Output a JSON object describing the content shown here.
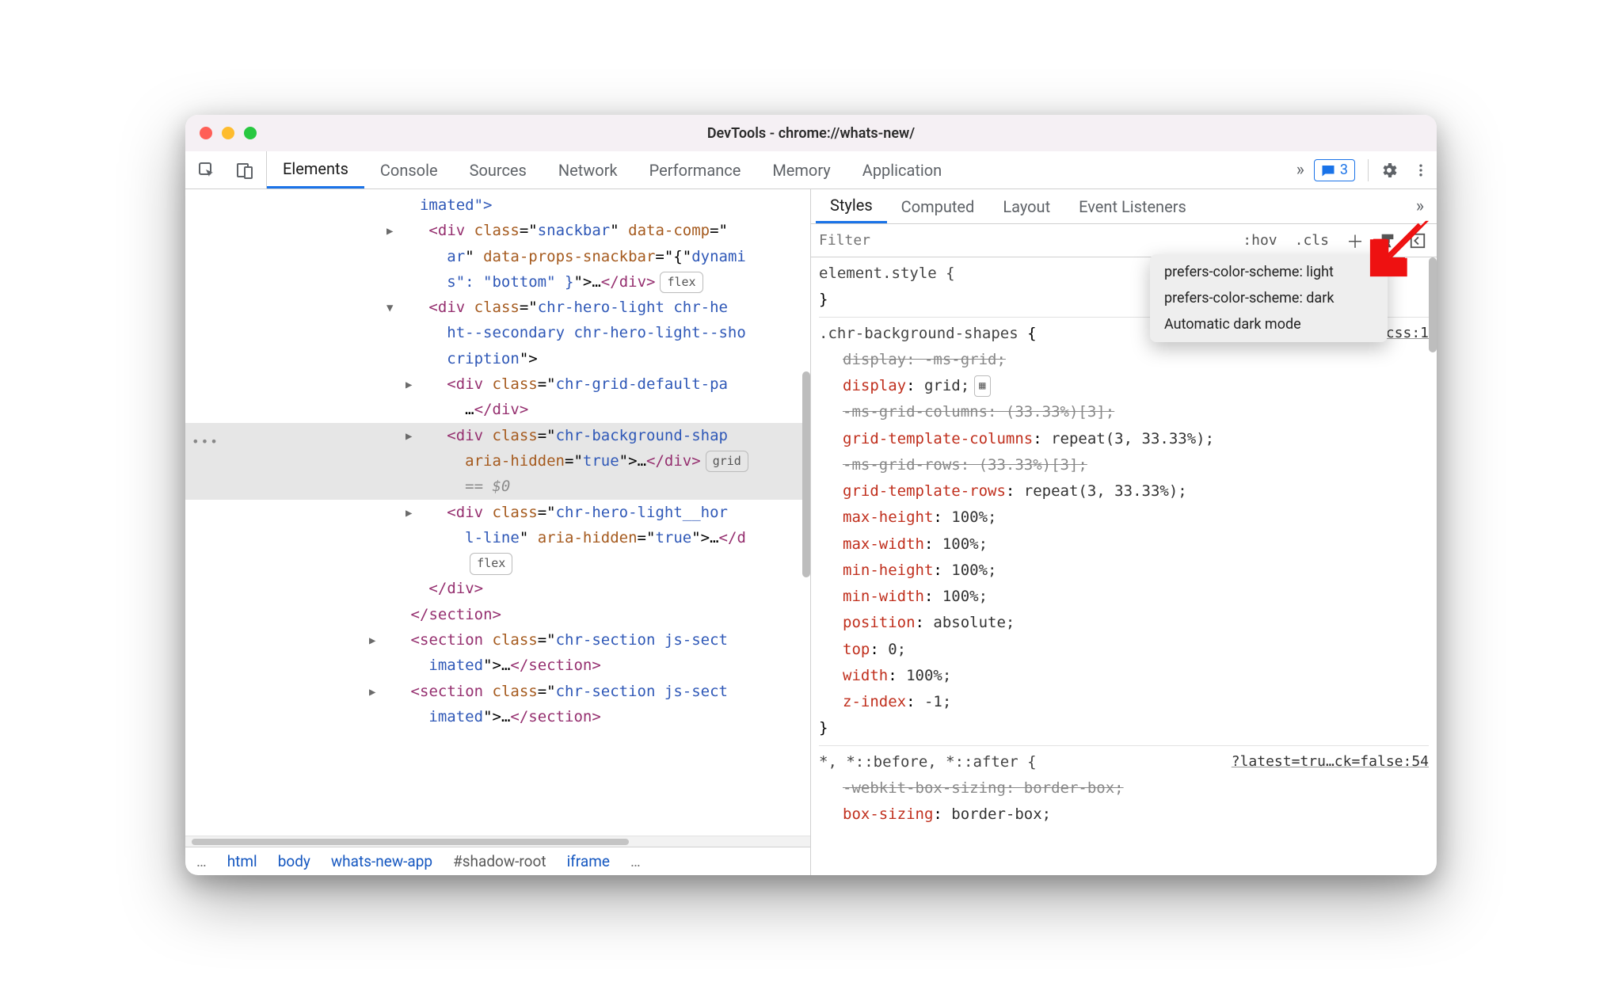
{
  "window_title": "DevTools - chrome://whats-new/",
  "tabs": {
    "items": [
      "Elements",
      "Console",
      "Sources",
      "Network",
      "Performance",
      "Memory",
      "Application"
    ],
    "active": "Elements"
  },
  "issues_badge": "3",
  "styles_tabs": {
    "items": [
      "Styles",
      "Computed",
      "Layout",
      "Event Listeners"
    ],
    "active": "Styles"
  },
  "filter": {
    "placeholder": "Filter",
    "hov": ":hov",
    "cls": ".cls"
  },
  "dropdown": {
    "items": [
      "prefers-color-scheme: light",
      "prefers-color-scheme: dark",
      "Automatic dark mode"
    ]
  },
  "breadcrumb": [
    "…",
    "html",
    "body",
    "whats-new-app",
    "#shadow-root",
    "iframe",
    "…"
  ],
  "dom": {
    "l1": "imated\">",
    "l2a": "<div ",
    "l2b": "class",
    "l2c": "=\"",
    "l2d": "snackbar",
    "l2e": "\" ",
    "l2f": "data-comp",
    "l2g": "=\"",
    "l3a": "ar\" ",
    "l3b": "data-props-snackbar",
    "l3c": "=\"{\"",
    "l3d": "dynami",
    "l4a": "s\": \"bottom\" }\">",
    "l4b": "…",
    "l4c": "</div>",
    "l4pill": "flex",
    "l5a": "<div ",
    "l5b": "class",
    "l5c": "=\"",
    "l5d": "chr-hero-light chr-he",
    "l6": "ht--secondary chr-hero-light--sho",
    "l7": "cription\">",
    "l8a": "<div ",
    "l8b": "class",
    "l8c": "=\"",
    "l8d": "chr-grid-default-pa",
    "l9a": "…",
    "l9b": "</div>",
    "l10a": "<div ",
    "l10b": "class",
    "l10c": "=\"",
    "l10d": "chr-background-shap",
    "l11a": "aria-hidden",
    "l11b": "=\"",
    "l11c": "true",
    "l11d": "\">",
    "l11e": "…",
    "l11f": "</div>",
    "l11pill": "grid",
    "l12": "== $0",
    "l13a": "<div ",
    "l13b": "class",
    "l13c": "=\"",
    "l13d": "chr-hero-light__hor",
    "l14a": "l-line",
    "l14b": "\" ",
    "l14c": "aria-hidden",
    "l14d": "=\"",
    "l14e": "true",
    "l14f": "\">",
    "l14g": "…",
    "l14h": "</d",
    "l15pill": "flex",
    "l16": "</div>",
    "l17": "</section>",
    "l18a": "<section ",
    "l18b": "class",
    "l18c": "=\"",
    "l18d": "chr-section js-sect",
    "l19a": "imated\">",
    "l19b": "…",
    "l19c": "</section>",
    "l20a": "<section ",
    "l20b": "class",
    "l20c": "=\"",
    "l20d": "chr-section js-sect",
    "l21a": "imated\">",
    "l21b": "…",
    "l21c": "</section>"
  },
  "styles": {
    "elstyle_sel": "element.style {",
    "elstyle_close": "}",
    "rule1_sel": ".chr-background-shapes",
    "rule1_src": ".css:1",
    "rule1": {
      "display_ms": "display: -ms-grid;",
      "display_n": "display",
      "display_v": "grid;",
      "mscols": "-ms-grid-columns: (33.33%)[3];",
      "gtc_n": "grid-template-columns",
      "gtc_v": "repeat(3, 33.33%);",
      "msrows": "-ms-grid-rows: (33.33%)[3];",
      "gtr_n": "grid-template-rows",
      "gtr_v": "repeat(3, 33.33%);",
      "maxh_n": "max-height",
      "maxh_v": "100%;",
      "maxw_n": "max-width",
      "maxw_v": "100%;",
      "minh_n": "min-height",
      "minh_v": "100%;",
      "minw_n": "min-width",
      "minw_v": "100%;",
      "pos_n": "position",
      "pos_v": "absolute;",
      "top_n": "top",
      "top_v": "0;",
      "w_n": "width",
      "w_v": "100%;",
      "z_n": "z-index",
      "z_v": "-1;"
    },
    "rule1_close": "}",
    "rule2_sel": "*, *::before, *::after {",
    "rule2_src": "?latest=tru…ck=false:54",
    "rule2": {
      "wbs": "-webkit-box-sizing: border-box;",
      "bs_n": "box-sizing",
      "bs_v": "border-box;"
    }
  }
}
